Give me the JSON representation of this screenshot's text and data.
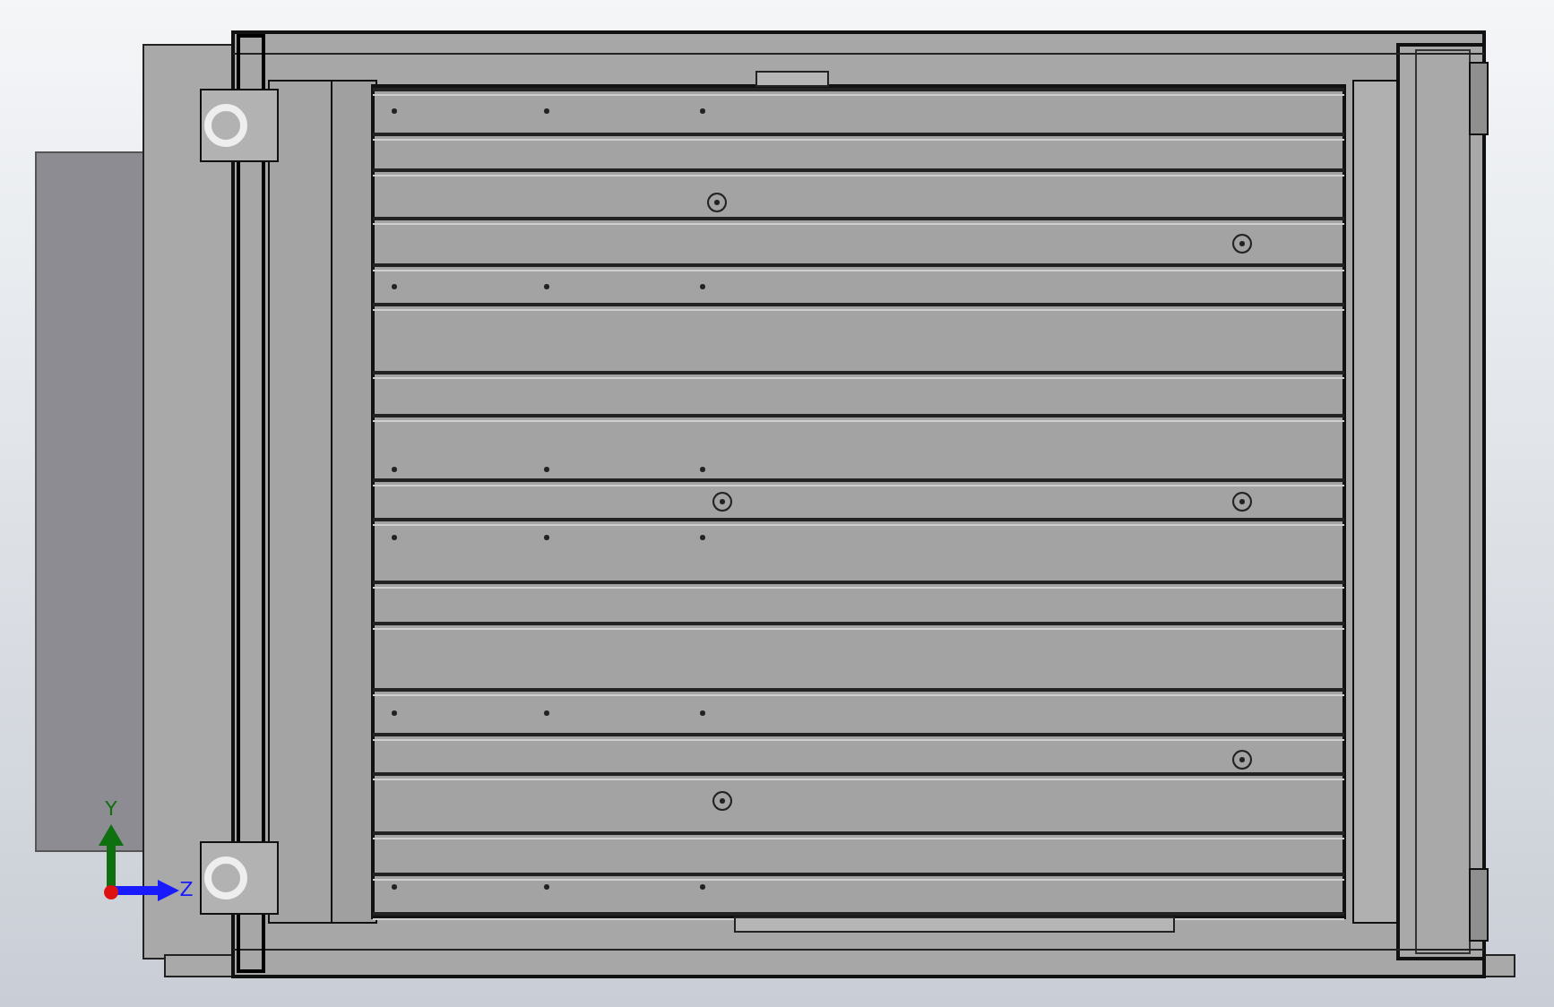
{
  "viewport": {
    "triad": {
      "axes": [
        {
          "kind": "vertical",
          "label": "Y",
          "color": "#0e700e"
        },
        {
          "kind": "horizontal",
          "label": "Z",
          "color": "#1a1aff"
        }
      ]
    }
  }
}
